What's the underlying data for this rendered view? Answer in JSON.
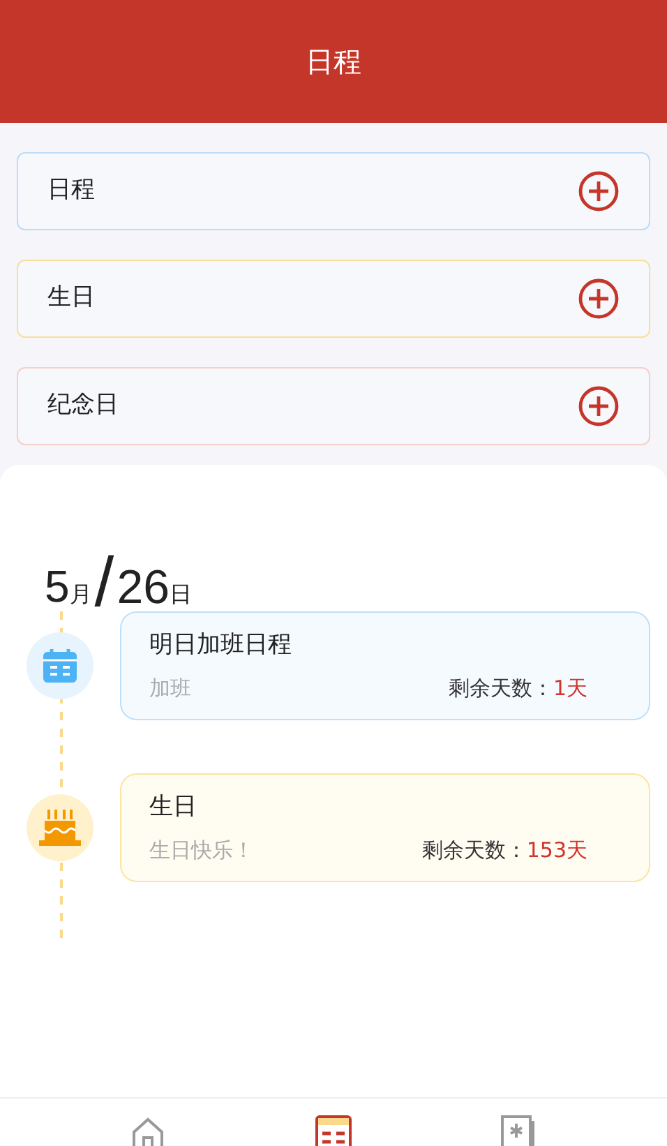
{
  "header": {
    "title": "日程"
  },
  "categories": [
    {
      "label": "日程",
      "color": "#bcdcf7"
    },
    {
      "label": "生日",
      "color": "#f8df9a"
    },
    {
      "label": "纪念日",
      "color": "#f6cfc9"
    }
  ],
  "date": {
    "month": "5",
    "month_unit": "月",
    "separator": "/",
    "day": "26",
    "day_unit": "日"
  },
  "events": [
    {
      "kind": "schedule",
      "title": "明日加班日程",
      "note": "加班",
      "remaining_label": "剩余天数：",
      "remaining": "1天"
    },
    {
      "kind": "birthday",
      "title": "生日",
      "note": "生日快乐！",
      "remaining_label": "剩余天数：",
      "remaining": "153天"
    }
  ],
  "nav": [
    {
      "kind": "home",
      "selected": false
    },
    {
      "kind": "calendar",
      "selected": true
    },
    {
      "kind": "note",
      "selected": false
    }
  ]
}
